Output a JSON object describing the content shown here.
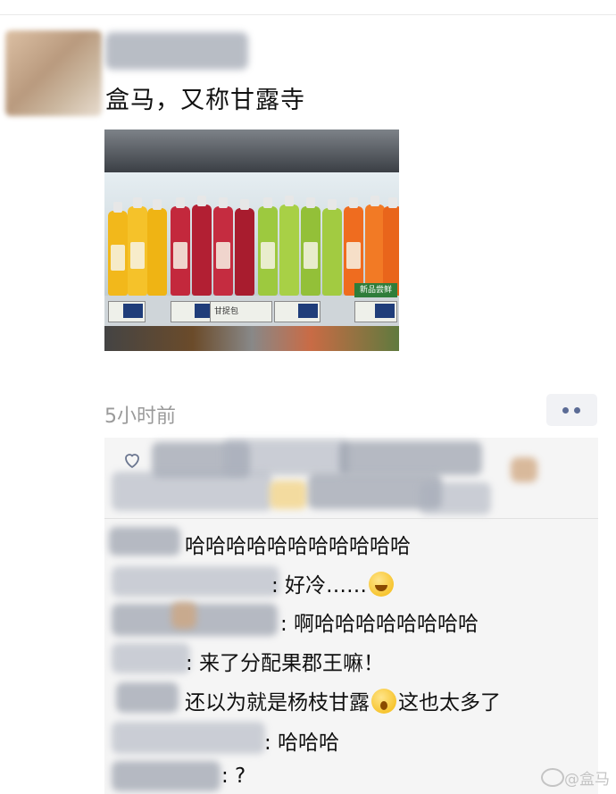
{
  "post": {
    "text": "盒马，又称甘露寺",
    "timestamp": "5小时前",
    "photo_tags": [
      "甘捉包",
      "新品尝鲜"
    ]
  },
  "comments": [
    {
      "text": "哈哈哈哈哈哈哈哈哈哈哈"
    },
    {
      "text": ": 好冷……",
      "emoji": "rolling-on-floor-laughing"
    },
    {
      "text": ": 啊哈哈哈哈哈哈哈哈"
    },
    {
      "text": ": 来了分配果郡王嘛！"
    },
    {
      "text_before": "还以为就是杨枝甘露",
      "emoji": "face-screaming",
      "text_after": "这也太多了"
    },
    {
      "text": ": 哈哈哈"
    },
    {
      "text": ": ?"
    }
  ],
  "watermark": {
    "text": "@盒马",
    "icon": "weibo-logo-icon"
  },
  "colors": {
    "panel_bg": "#f5f5f5",
    "more_dots": "#5b6b95",
    "timestamp": "#9a9a9a"
  }
}
